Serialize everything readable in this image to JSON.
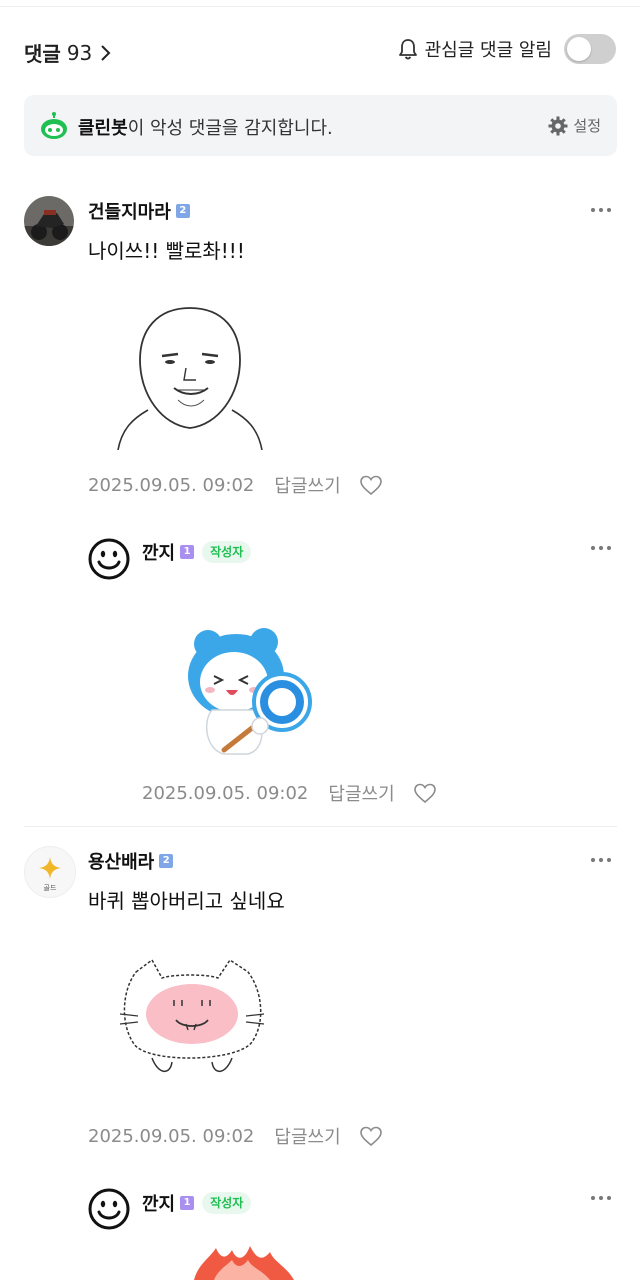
{
  "header": {
    "comments_label": "댓글",
    "comments_count": "93",
    "notify_label": "관심글 댓글 알림",
    "notify_on": false
  },
  "cleanbot": {
    "name": "클린봇",
    "text": "이 악성 댓글을 감지합니다.",
    "settings_label": "설정"
  },
  "comments": [
    {
      "nickname": "건들지마라",
      "level": "2",
      "text": "나이쓰!! 빨로촤!!!",
      "date": "2025.09.05. 09:02",
      "reply_label": "답글쓰기",
      "sticker": "bald-man-face-sticker"
    },
    {
      "nickname": "깐지",
      "level": "1",
      "badge": "작성자",
      "date": "2025.09.05. 09:02",
      "reply_label": "답글쓰기",
      "sticker": "blue-bear-circle-sign-sticker"
    },
    {
      "nickname": "용산배라",
      "level": "2",
      "avatar_badge": "골드",
      "text": "바퀴 뽑아버리고 싶네요",
      "date": "2025.09.05. 09:02",
      "reply_label": "답글쓰기",
      "sticker": "blushing-cat-sticker"
    },
    {
      "nickname": "깐지",
      "level": "1",
      "badge": "작성자",
      "sticker": "red-flame-sticker"
    }
  ],
  "colors": {
    "accent_green": "#1fbf52",
    "level_blue": "#7fa7e8",
    "level_purple": "#a98ff0",
    "banner_bg": "#f2f4f6"
  }
}
